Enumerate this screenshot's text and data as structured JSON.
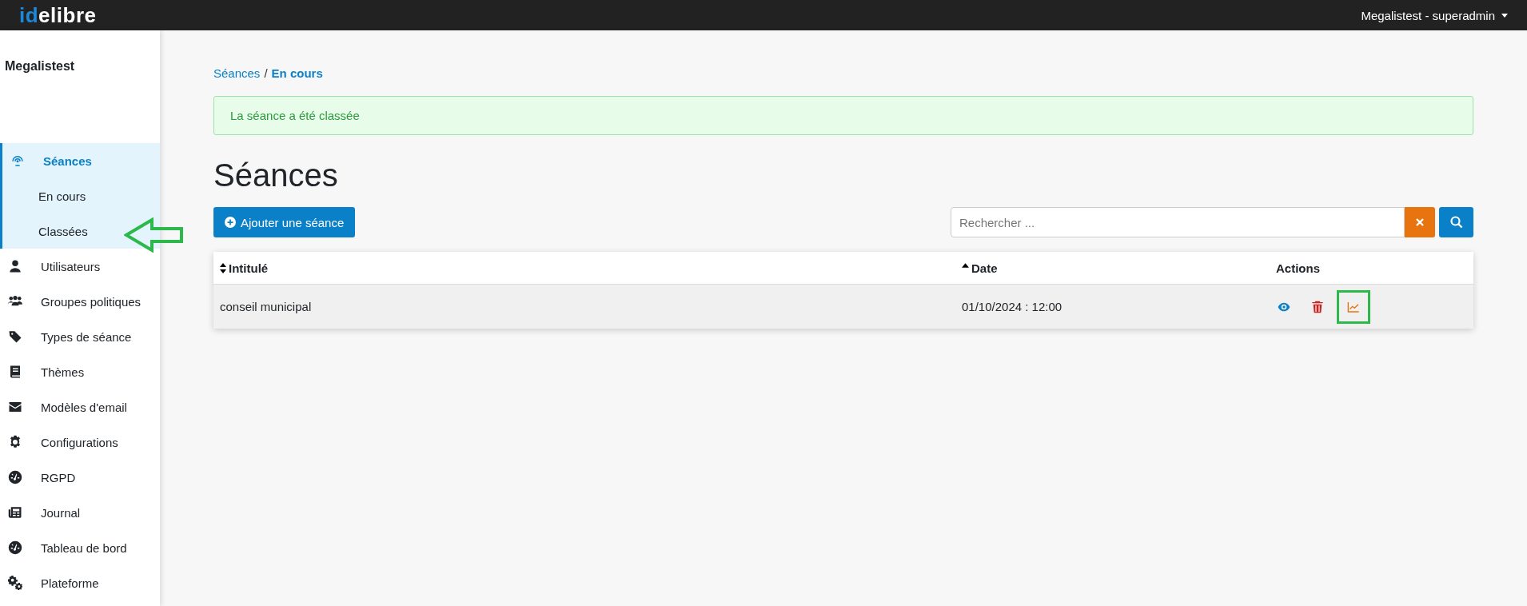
{
  "topbar": {
    "logo_accent": "id",
    "logo_rest": "elibre",
    "user_menu": "Megalistest - superadmin"
  },
  "sidebar": {
    "title": "Megalistest",
    "items": [
      {
        "label": "Séances",
        "selected": true,
        "expanded": true,
        "annotated": false,
        "children": [
          {
            "label": "En cours",
            "selected": false,
            "annotated": false
          },
          {
            "label": "Classées",
            "selected": false,
            "annotated": true
          }
        ]
      },
      {
        "label": "Utilisateurs",
        "selected": false,
        "expanded": false,
        "annotated": false
      },
      {
        "label": "Groupes politiques",
        "selected": false,
        "expanded": false,
        "annotated": false
      },
      {
        "label": "Types de séance",
        "selected": false,
        "expanded": false,
        "annotated": false
      },
      {
        "label": "Thèmes",
        "selected": false,
        "expanded": false,
        "annotated": false
      },
      {
        "label": "Modèles d'email",
        "selected": false,
        "expanded": false,
        "annotated": false
      },
      {
        "label": "Configurations",
        "selected": false,
        "expanded": false,
        "annotated": false
      },
      {
        "label": "RGPD",
        "selected": false,
        "expanded": false,
        "annotated": false
      },
      {
        "label": "Journal",
        "selected": false,
        "expanded": false,
        "annotated": false
      },
      {
        "label": "Tableau de bord",
        "selected": false,
        "expanded": false,
        "annotated": false
      },
      {
        "label": "Plateforme",
        "selected": false,
        "expanded": false,
        "annotated": false
      }
    ]
  },
  "breadcrumb": [
    "Séances",
    "/",
    "En cours"
  ],
  "alert": {
    "kind": "success",
    "text": "La séance a été classée"
  },
  "page_title": "Séances",
  "add_button": "Ajouter une séance",
  "search": {
    "placeholder": "Rechercher ..."
  },
  "table": {
    "columns": [
      {
        "label": "Intitulé",
        "sortable": true,
        "sorted": false
      },
      {
        "label": "Date",
        "sortable": true,
        "sorted": true
      },
      {
        "label": "Actions",
        "sortable": false
      }
    ],
    "rows": [
      {
        "cells": [
          "conseil municipal",
          "01/10/2024 : 12:00"
        ],
        "actions": [
          {
            "kind": "view",
            "highlighted": false
          },
          {
            "kind": "delete",
            "highlighted": false
          },
          {
            "kind": "stats",
            "highlighted": true
          }
        ]
      }
    ]
  }
}
